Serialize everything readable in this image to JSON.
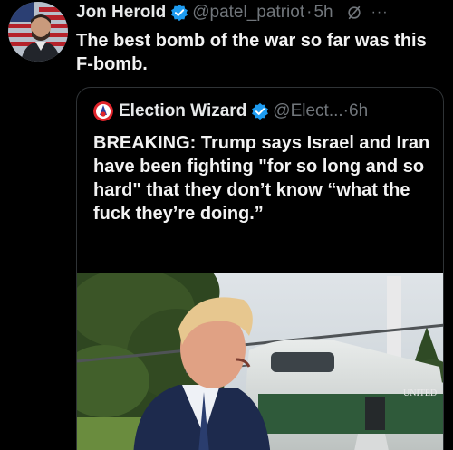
{
  "post": {
    "author_name": "Jon Herold",
    "handle": "@patel_patriot",
    "separator": "·",
    "time": "5h",
    "more_label": "···",
    "text": "The best bomb of the war so far was this F-bomb."
  },
  "quoted_post": {
    "author_name": "Election Wizard",
    "handle": "@Elect...",
    "separator": "·",
    "time": "6h",
    "text": "BREAKING: Trump says Israel and Iran have been fighting \"for so long and so hard\" that they don’t know “what the fuck they’re doing.”",
    "photo_lettering": "UNITED"
  },
  "colors": {
    "verified_badge": "#1d9bf0",
    "muted_text": "#71767b",
    "quote_border": "#2f3336"
  },
  "icons": [
    "verified-badge-icon",
    "grok-icon",
    "more-options-icon"
  ]
}
